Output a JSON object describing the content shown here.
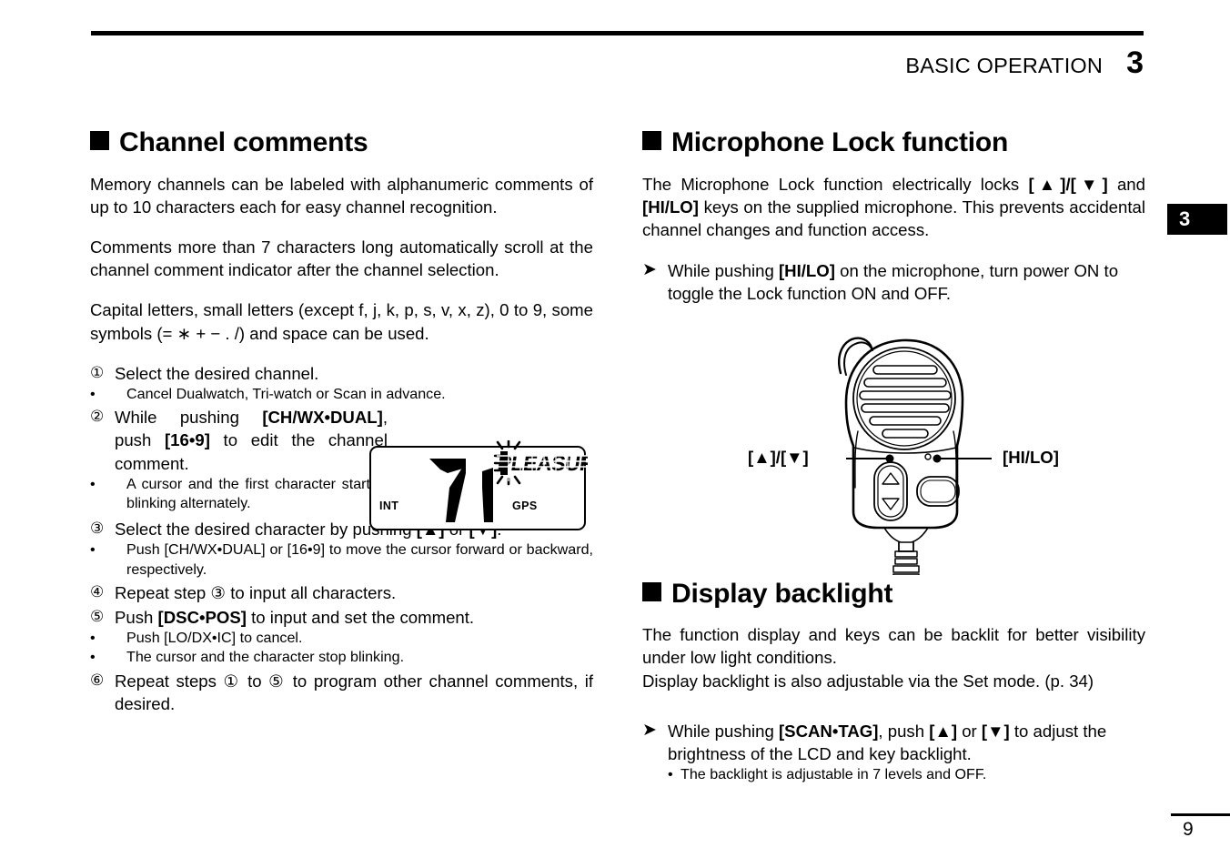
{
  "header": {
    "title": "BASIC OPERATION",
    "chapter": "3",
    "side_tab": "3"
  },
  "footer": {
    "page_number": "9"
  },
  "left_column": {
    "section_title": "Channel comments",
    "paragraph_1": "Memory channels can be labeled with alphanumeric comments of up to 10 characters each for easy channel recognition.",
    "paragraph_2": "Comments more than 7 characters long automatically scroll at the channel comment indicator after the channel selection.",
    "paragraph_3": "Capital letters, small letters (except f, j, k, p, s, v, x, z), 0 to 9, some symbols (= ∗ + − . /) and space can be used.",
    "steps": [
      {
        "num": "①",
        "text": "Select the desired channel.",
        "bullets": [
          "Cancel Dualwatch, Tri-watch or Scan in advance."
        ]
      },
      {
        "num": "②",
        "text_parts": [
          "While pushing ",
          "[CH/WX•DUAL]",
          ", push ",
          "[16•9]",
          " to edit the channel comment."
        ],
        "bullets": [
          "A cursor and the first character start blinking alternately."
        ]
      },
      {
        "num": "③",
        "text_parts": [
          "Select the desired character by pushing ",
          "[▲]",
          " or ",
          "[▼]",
          "."
        ],
        "bullets": [
          "Push [CH/WX•DUAL] or [16•9] to move the cursor forward or backward, respectively."
        ]
      },
      {
        "num": "④",
        "text": "Repeat step ③ to input all characters.",
        "bullets": []
      },
      {
        "num": "⑤",
        "text_parts": [
          "Push ",
          "[DSC•POS]",
          " to input and set the comment."
        ],
        "bullets": [
          "Push [LO/DX•IC] to cancel.",
          "The cursor and the character stop blinking."
        ]
      },
      {
        "num": "⑥",
        "text": "Repeat steps ① to ⑤ to program other channel comments, if desired.",
        "bullets": []
      }
    ],
    "lcd_figure": {
      "channel": "71",
      "comment": "PLEASUR",
      "label_left": "INT",
      "label_right": "GPS"
    }
  },
  "right_column": {
    "section_1": {
      "title": "Microphone Lock function",
      "paragraph_parts": [
        "The Microphone Lock function electrically locks ",
        "[▲]/[▼]",
        " and ",
        "[HI/LO]",
        " keys on the supplied microphone. This prevents accidental channel changes and function access."
      ],
      "instruction_parts": [
        "While pushing ",
        "[HI/LO]",
        " on the microphone, turn power ON to toggle the Lock function ON and OFF."
      ],
      "figure": {
        "label_left": "[▲]/[▼]",
        "label_right": "[HI/LO]"
      }
    },
    "section_2": {
      "title": "Display backlight",
      "paragraph_1": "The function display and keys can be backlit for better visibility under low light conditions.",
      "paragraph_2": "Display backlight is also adjustable via the Set mode. (p. 34)",
      "instruction_parts": [
        "While pushing ",
        "[SCAN•TAG]",
        ", push ",
        "[▲]",
        " or ",
        "[▼]",
        " to adjust the brightness of the LCD and key backlight."
      ],
      "bullet": "The backlight is adjustable in 7 levels and OFF."
    }
  }
}
